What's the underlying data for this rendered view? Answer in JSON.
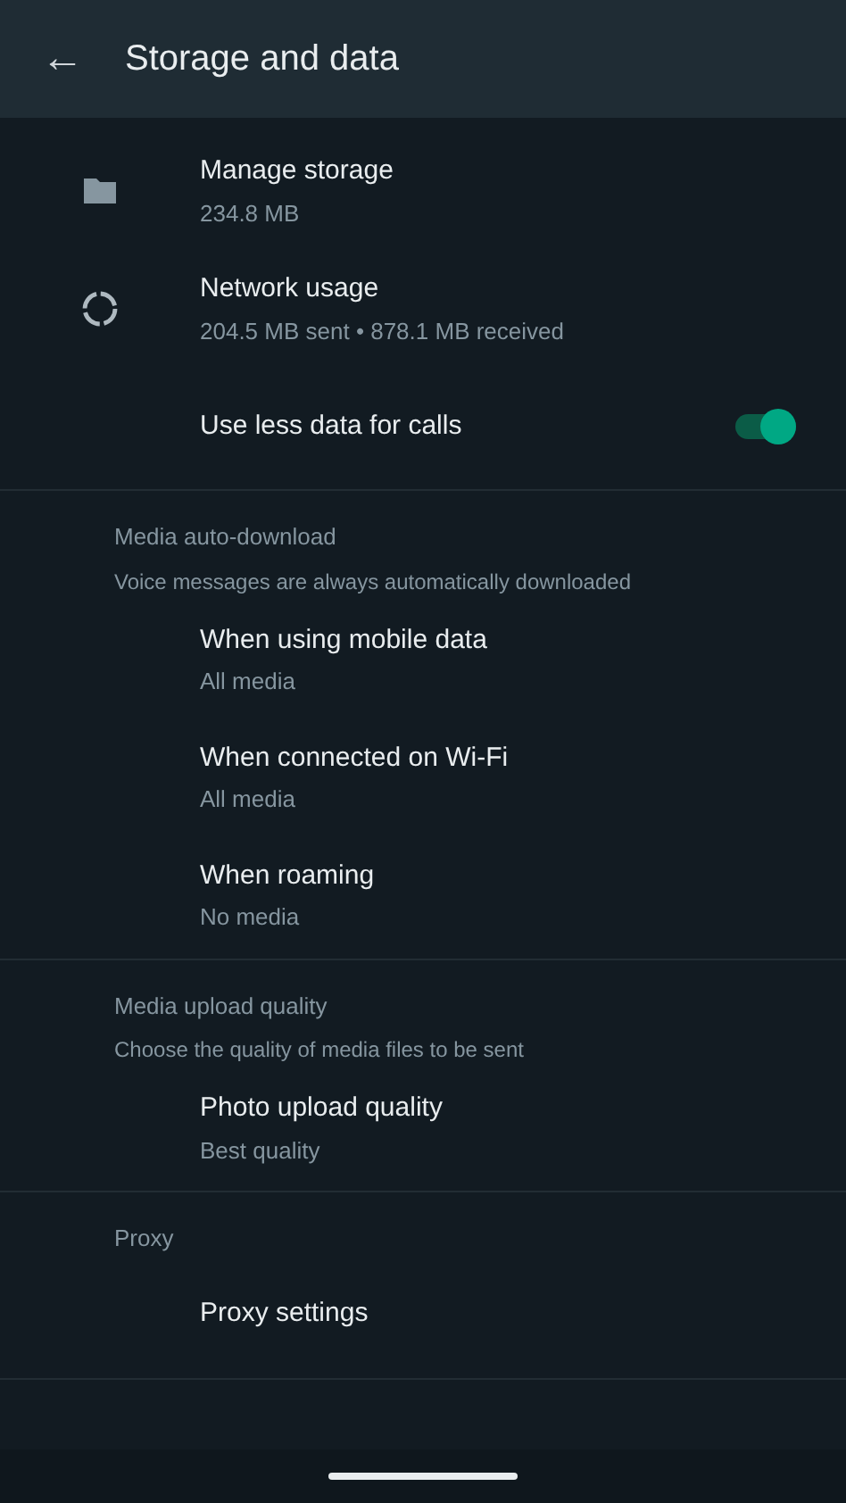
{
  "app_bar": {
    "back": "←",
    "title": "Storage and data"
  },
  "sections": [
    {
      "items": [
        {
          "kind": "nav",
          "title": "Manage storage",
          "subtitle": "234.8 MB"
        },
        {
          "kind": "nav",
          "title": "Network usage",
          "subtitle": "204.5 MB sent • 878.1 MB received"
        },
        {
          "kind": "toggle",
          "title": "Use less data for calls",
          "on": true
        }
      ]
    },
    {
      "header": "Media auto-download",
      "description": "Voice messages are always automatically downloaded",
      "items": [
        {
          "kind": "nav",
          "title": "When using mobile data",
          "subtitle": "All media"
        },
        {
          "kind": "nav",
          "title": "When connected on Wi-Fi",
          "subtitle": "All media"
        },
        {
          "kind": "nav",
          "title": "When roaming",
          "subtitle": "No media"
        }
      ]
    },
    {
      "header": "Media upload quality",
      "description": "Choose the quality of media files to be sent",
      "items": [
        {
          "kind": "nav",
          "title": "Photo upload quality",
          "subtitle": "Best quality"
        }
      ]
    },
    {
      "header": "Proxy",
      "items": [
        {
          "kind": "nav",
          "title": "Proxy settings"
        }
      ]
    }
  ]
}
